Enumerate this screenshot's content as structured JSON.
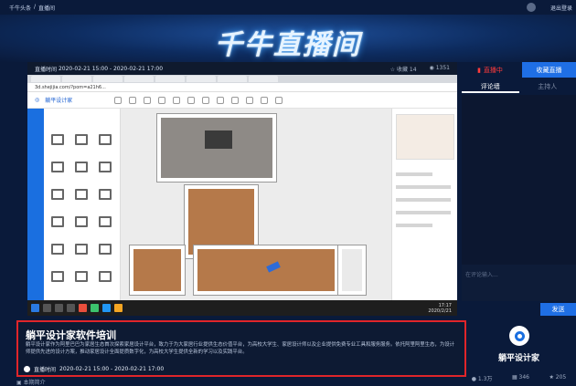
{
  "topbar": {
    "crumbs": [
      "千牛头条",
      "/",
      "直播间"
    ],
    "logout": "退出登录"
  },
  "hero": {
    "title": "千牛直播间"
  },
  "player": {
    "time_label": "直播时间",
    "time_range": "2020-02-21 15:00 - 2020-02-21 17:00",
    "favorites_label": "收藏",
    "favorites": "14",
    "viewers": "1351"
  },
  "screen": {
    "url": "3d.shejijia.com/?pom=a21h6...",
    "app_name": "躺平设计家",
    "clock": "17:17",
    "date": "2020/2/21"
  },
  "info": {
    "title": "躺平设计家软件培训",
    "description": "躺平设计家作为阿里巴巴为家居生态首次探索家居设计平台，致力于为大家居行业提供生态价值平台，为高校大学生、家居设计师以及企业提供免费专业工具和服务服务。依托阿里阿里生态，为设计师提供先进的设计方案，推动家居设计全面提质数字化，为高校大学生提供全新的学习以及实践平台。",
    "time_label": "直播时间",
    "time_range": "2020-02-21 15:00 - 2020-02-21 17:00"
  },
  "side": {
    "status": "直播中",
    "follow": "收藏直播",
    "tabs": [
      "评论墙",
      "主持人"
    ],
    "input_placeholder": "在评论输入...",
    "send": "发送"
  },
  "anchor": {
    "name": "躺平设计家",
    "stats": [
      "1.3万",
      "346",
      "205"
    ]
  },
  "bottom": {
    "label": "本期简介"
  },
  "colors": {
    "accent": "#1f6fe5",
    "live": "#ff3b3b",
    "highlight_border": "#e0252a",
    "page_bg": "#0a1a3a"
  }
}
